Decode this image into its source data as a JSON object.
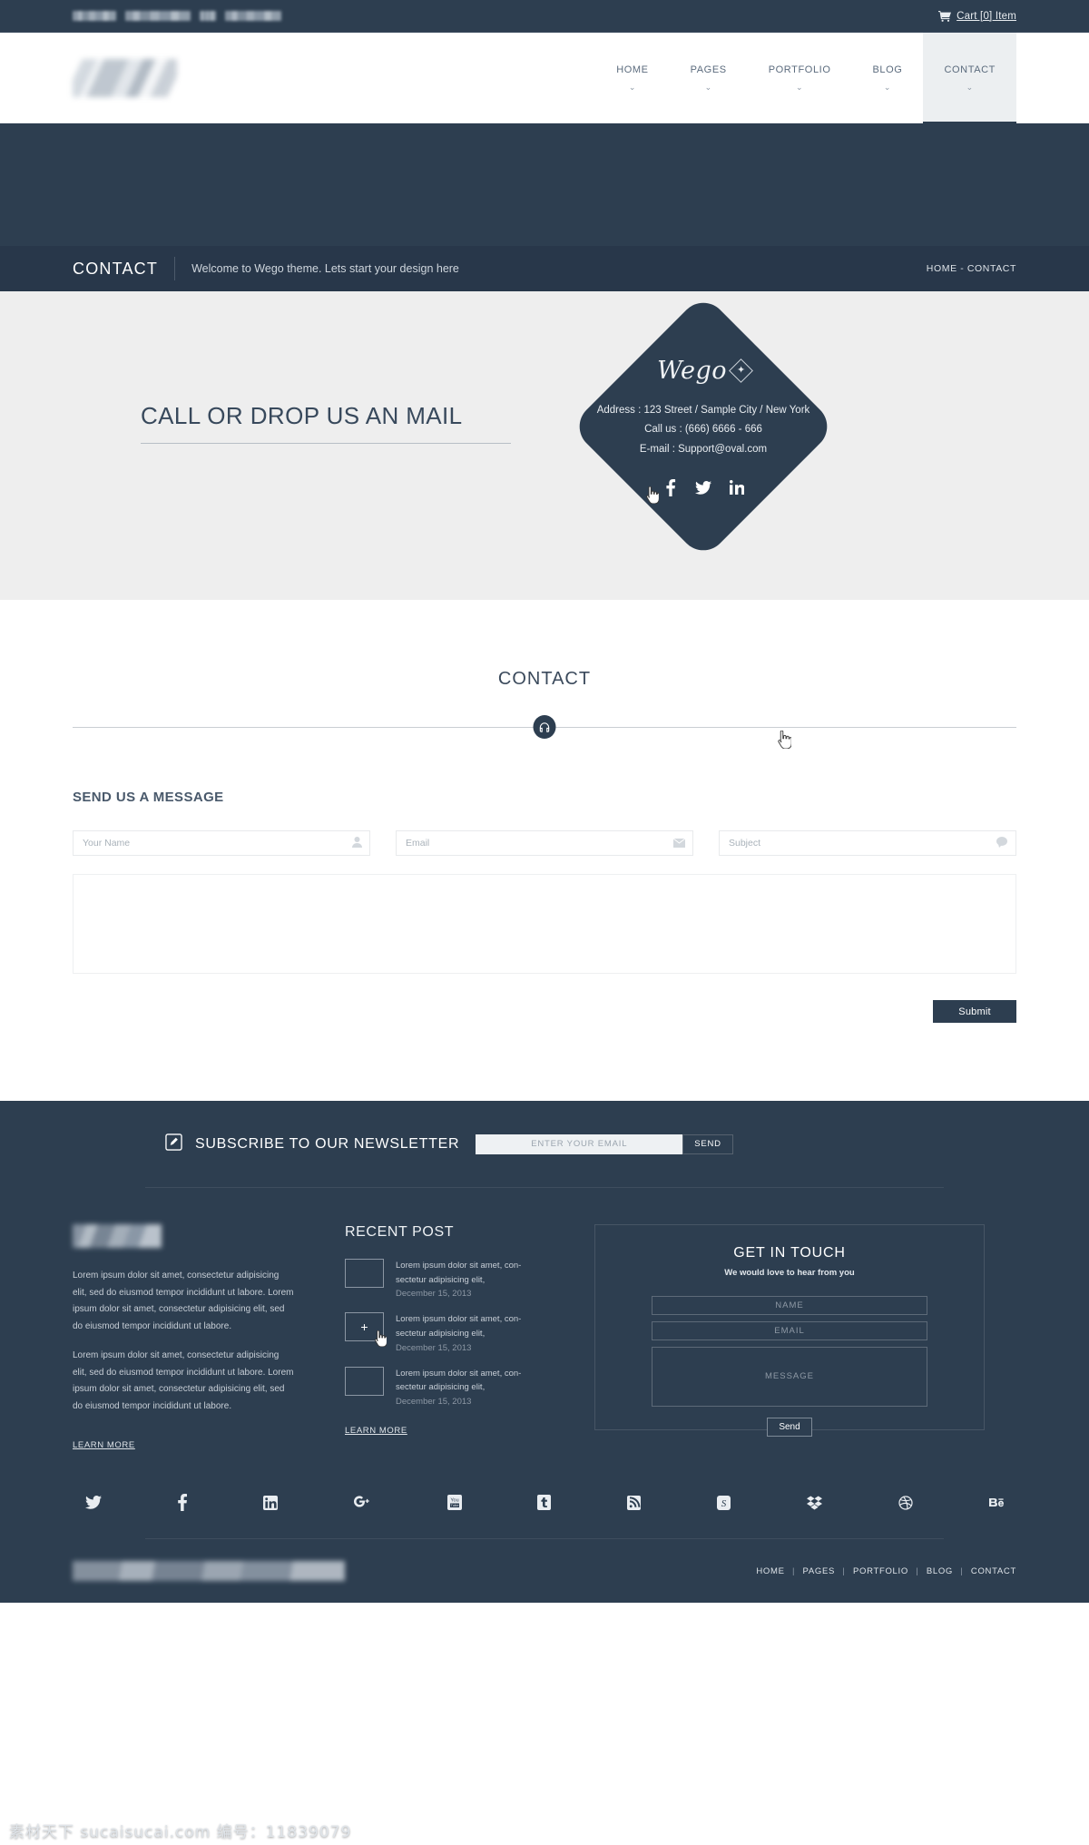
{
  "colors": {
    "dark": "#2d3e50",
    "dark_title": "#28374a",
    "grey_band": "#eeeeee",
    "text_muted": "#c7ced6"
  },
  "topbar": {
    "cart_label": "Cart [0] Item",
    "cart_icon": "shopping-cart-icon",
    "left_placeholder": "(blurred text)"
  },
  "header": {
    "logo_alt": "Wego logo (blurred)",
    "nav": [
      {
        "label": "HOME",
        "caret": "⌄",
        "active": false
      },
      {
        "label": "PAGES",
        "caret": "⌄",
        "active": false
      },
      {
        "label": "PORTFOLIO",
        "caret": "⌄",
        "active": false
      },
      {
        "label": "BLOG",
        "caret": "⌄",
        "active": false
      },
      {
        "label": "CONTACT",
        "caret": "⌄",
        "active": true
      }
    ]
  },
  "titlebar": {
    "title": "CONTACT",
    "subtitle": "Welcome to Wego theme. Lets start your design here",
    "breadcrumb": "HOME -  CONTACT"
  },
  "hero_band": {
    "heading": "CALL OR DROP US AN MAIL"
  },
  "diamond": {
    "brand": "Wego",
    "brand_mark": "✦",
    "address": "Address : 123 Street / Sample City /  New York",
    "phone": "Call us : (666)  6666 - 666",
    "email": "E-mail : Support@oval.com",
    "socials": [
      {
        "name": "facebook-icon",
        "glyph": "f"
      },
      {
        "name": "twitter-icon",
        "glyph": "t"
      },
      {
        "name": "linkedin-icon",
        "glyph": "in"
      }
    ]
  },
  "contact_section": {
    "title": "CONTACT",
    "divider_icon": "headphones-icon",
    "form_heading": "SEND US A MESSAGE",
    "fields": [
      {
        "placeholder": "Your Name",
        "value": "",
        "icon": "user-icon"
      },
      {
        "placeholder": "Email",
        "value": "",
        "icon": "envelope-icon"
      },
      {
        "placeholder": "Subject",
        "value": "",
        "icon": "comment-icon"
      }
    ],
    "message_placeholder": "",
    "message_value": "",
    "submit_label": "Submit"
  },
  "footer": {
    "newsletter": {
      "icon": "pencil-square-icon",
      "title": "SUBSCRIBE TO OUR NEWSLETTER",
      "placeholder": "ENTER YOUR EMAIL",
      "value": "",
      "button_label": "SEND"
    },
    "about": {
      "logo_alt": "Wego footer logo (blurred)",
      "paragraphs": [
        "Lorem ipsum dolor sit amet, consectetur adipisicing elit, sed do eiusmod tempor incididunt ut labore. Lorem ipsum dolor sit amet, consectetur adipisicing elit, sed do eiusmod tempor incididunt ut labore.",
        "Lorem ipsum dolor sit amet, consectetur adipisicing elit, sed do eiusmod tempor incididunt ut labore. Lorem ipsum dolor sit amet, consectetur adipisicing elit, sed do eiusmod tempor incididunt ut labore."
      ],
      "learn_more": "LEARN MORE"
    },
    "recent_post": {
      "title": "RECENT POST",
      "items": [
        {
          "text": "Lorem ipsum dolor sit amet, con-sectetur adipisicing elit,",
          "date": "December 15, 2013",
          "thumb": ""
        },
        {
          "text": "Lorem ipsum dolor sit amet, con-sectetur adipisicing elit,",
          "date": "December 15, 2013",
          "thumb": "+"
        },
        {
          "text": "Lorem ipsum dolor sit amet, con-sectetur adipisicing elit,",
          "date": "December 15, 2013",
          "thumb": ""
        }
      ],
      "learn_more": "LEARN MORE"
    },
    "get_in_touch": {
      "title": "GET IN TOUCH",
      "subtitle": "We would love to hear from you",
      "name_placeholder": "NAME",
      "email_placeholder": "EMAIL",
      "message_placeholder": "MESSAGE",
      "send_label": "Send"
    },
    "socials": [
      {
        "name": "twitter-icon",
        "glyph": "t"
      },
      {
        "name": "facebook-icon",
        "glyph": "f"
      },
      {
        "name": "linkedin-icon",
        "glyph": "in"
      },
      {
        "name": "google-plus-icon",
        "glyph": "g+"
      },
      {
        "name": "youtube-icon",
        "glyph": "You"
      },
      {
        "name": "tumblr-icon",
        "glyph": "t"
      },
      {
        "name": "rss-icon",
        "glyph": "rss"
      },
      {
        "name": "skype-icon",
        "glyph": "S"
      },
      {
        "name": "dropbox-icon",
        "glyph": "db"
      },
      {
        "name": "dribbble-icon",
        "glyph": "o"
      },
      {
        "name": "behance-icon",
        "glyph": "Be"
      }
    ],
    "bottom": {
      "copyright_alt": "copyright text (blurred)",
      "links": [
        "HOME",
        "PAGES",
        "PORTFOLIO",
        "BLOG",
        "CONTACT"
      ],
      "separator": "|"
    }
  },
  "watermark": {
    "text": "素材天下 sucaisucai.com  编号：11839079"
  }
}
